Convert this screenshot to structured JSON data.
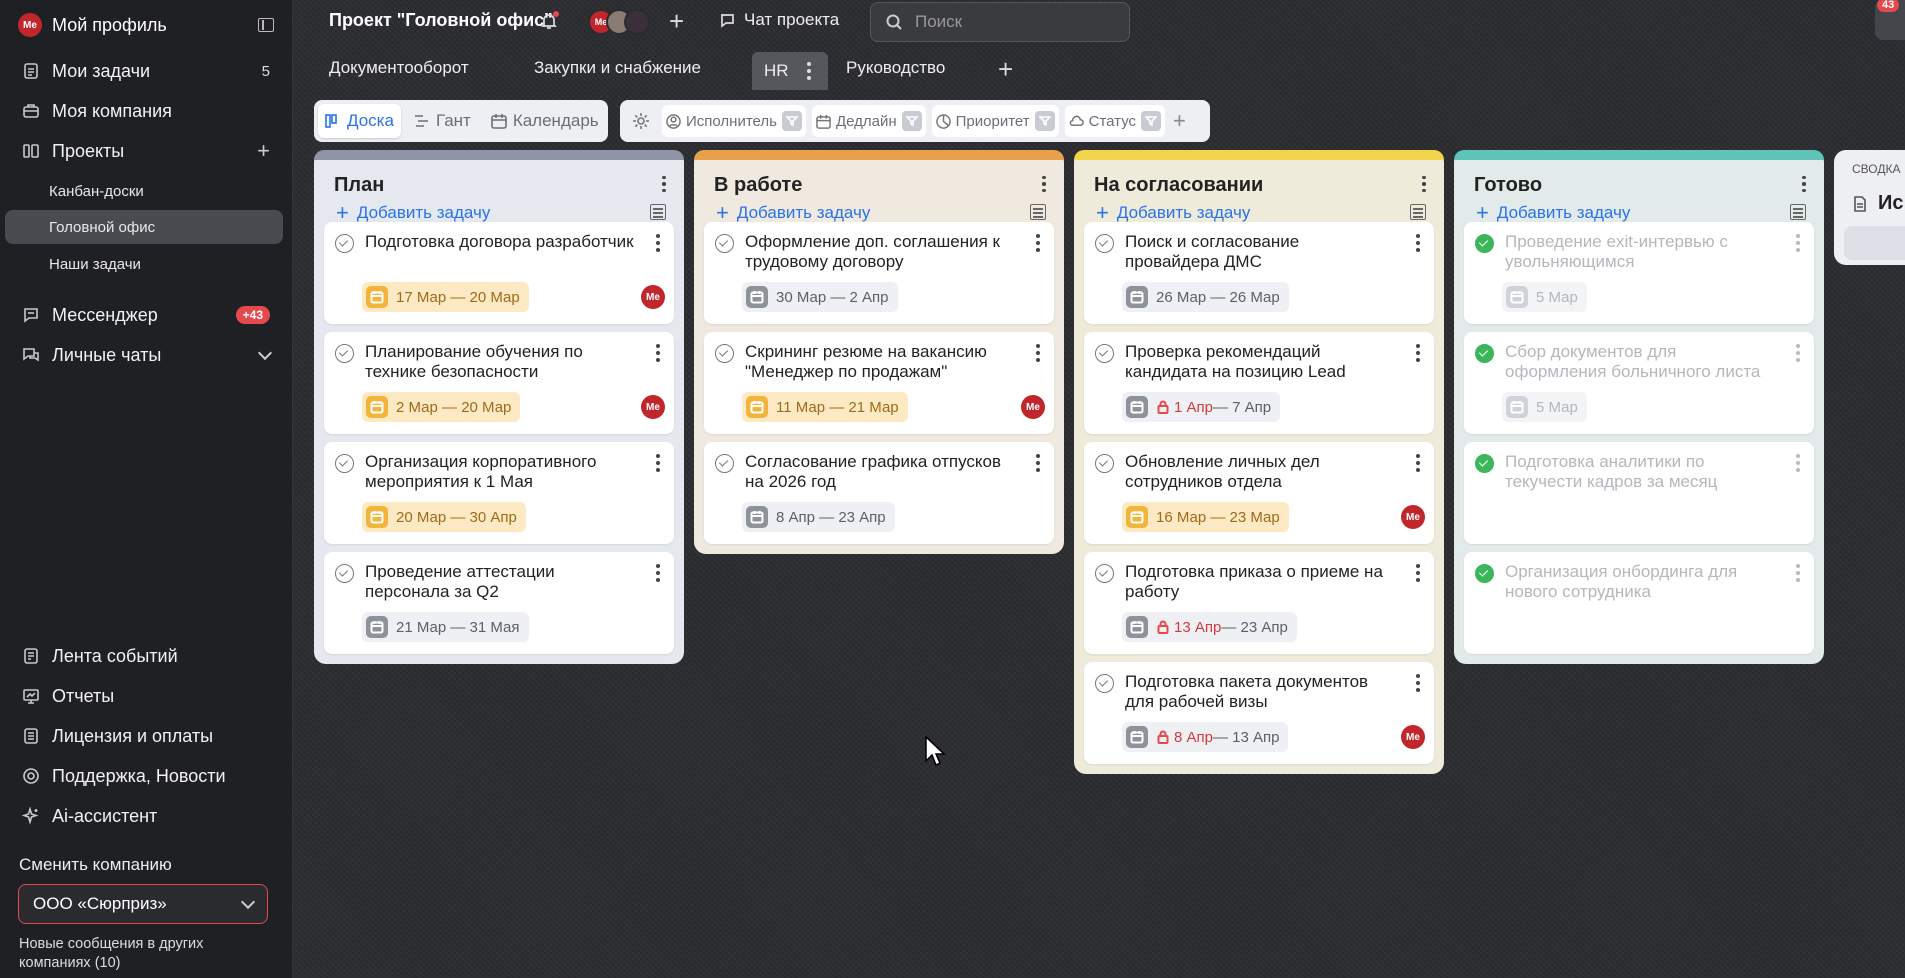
{
  "profile": {
    "avatar": "Me",
    "name": "Мой профиль"
  },
  "sidebar": {
    "my_tasks": {
      "label": "Мои задачи",
      "count": "5"
    },
    "my_company": "Моя компания",
    "projects": "Проекты",
    "project_items": [
      "Канбан-доски",
      "Головной офис",
      "Наши задачи"
    ],
    "messenger": {
      "label": "Мессенджер",
      "badge": "+43"
    },
    "personal_chats": "Личные чаты",
    "bottom": [
      "Лента событий",
      "Отчеты",
      "Лицензия и оплаты",
      "Поддержка, Новости",
      "Ai-ассистент"
    ],
    "change_company_label": "Сменить компанию",
    "company_value": "ООО «Сюрприз»",
    "news_note": "Новые сообщения в других компаниях (10)"
  },
  "header": {
    "project_title": "Проект \"Головной офис\"",
    "member_avatar": "Me",
    "chat_label": "Чат проекта",
    "search_placeholder": "Поиск",
    "chat_badge": "43"
  },
  "tabs": [
    "Документооборот",
    "Закупки и снабжение",
    "HR",
    "Руководство"
  ],
  "views": [
    "Доска",
    "Гант",
    "Календарь"
  ],
  "filters": [
    "Исполнитель",
    "Дедлайн",
    "Приоритет",
    "Статус"
  ],
  "columns": [
    {
      "title": "План",
      "color": "#8f93a6",
      "bg": "#e6e8ef",
      "add_label": "Добавить задачу",
      "cards": [
        {
          "title": "Подготовка договора разработчик",
          "date": "17 Мар — 20 Мар",
          "chip": "yellow",
          "assignee": "Me"
        },
        {
          "title": "Планирование обучения по технике безопасности",
          "date": "2 Мар — 20 Мар",
          "chip": "yellow",
          "assignee": "Me"
        },
        {
          "title": "Организация корпоративного мероприятия к 1 Мая",
          "date": "20 Мар — 30 Апр",
          "chip": "yellow",
          "assignee": ""
        },
        {
          "title": "Проведение аттестации персонала за Q2",
          "date": "21 Мар — 31 Мая",
          "chip": "gray",
          "assignee": ""
        }
      ]
    },
    {
      "title": "В работе",
      "color": "#e8a04a",
      "bg": "#efe9e0",
      "add_label": "Добавить задачу",
      "cards": [
        {
          "title": "Оформление доп. соглашения к трудовому договору",
          "date": "30 Мар — 2 Апр",
          "chip": "gray",
          "assignee": ""
        },
        {
          "title": "Скрининг резюме на вакансию \"Менеджер по продажам\"",
          "date": "11 Мар — 21 Мар",
          "chip": "yellow",
          "assignee": "Me"
        },
        {
          "title": "Согласование графика отпусков на 2026 год",
          "date": "8 Апр — 23 Апр",
          "chip": "gray",
          "assignee": ""
        }
      ]
    },
    {
      "title": "На согласовании",
      "color": "#f2d54a",
      "bg": "#eeebdb",
      "add_label": "Добавить задачу",
      "cards": [
        {
          "title": "Поиск и согласование провайдера ДМС",
          "date": "26 Мар — 26 Мар",
          "chip": "gray",
          "assignee": ""
        },
        {
          "title": "Проверка рекомендаций кандидата на позицию Lead",
          "date_start": "1 Апр",
          "date_end": " — 7 Апр",
          "chip": "red",
          "assignee": ""
        },
        {
          "title": "Обновление личных дел сотрудников отдела",
          "date": "16 Мар — 23 Мар",
          "chip": "yellow",
          "assignee": "Me"
        },
        {
          "title": "Подготовка приказа о приеме на работу",
          "date_start": "13 Апр",
          "date_end": " — 23 Апр",
          "chip": "red",
          "assignee": ""
        },
        {
          "title": "Подготовка пакета документов для рабочей визы",
          "date_start": "8 Апр",
          "date_end": " — 13 Апр",
          "chip": "red",
          "assignee": "Me"
        }
      ]
    },
    {
      "title": "Готово",
      "color": "#5ec4b8",
      "bg": "#e2ebea",
      "add_label": "Добавить задачу",
      "cards": [
        {
          "title": "Проведение exit-интервью с увольняющимся",
          "date": "5 Мар",
          "chip": "gray",
          "assignee": "",
          "done": true
        },
        {
          "title": "Сбор документов для оформления больничного листа",
          "date": "5 Мар",
          "chip": "gray",
          "assignee": "",
          "done": true
        },
        {
          "title": "Подготовка аналитики по текучести кадров за месяц",
          "date": "",
          "chip": "",
          "assignee": "",
          "done": true
        },
        {
          "title": "Организация онбординга для нового сотрудника",
          "date": "",
          "chip": "",
          "assignee": "",
          "done": true
        }
      ]
    }
  ],
  "summary_column": {
    "label": "СВОДКА",
    "doc_title": "Ис"
  }
}
